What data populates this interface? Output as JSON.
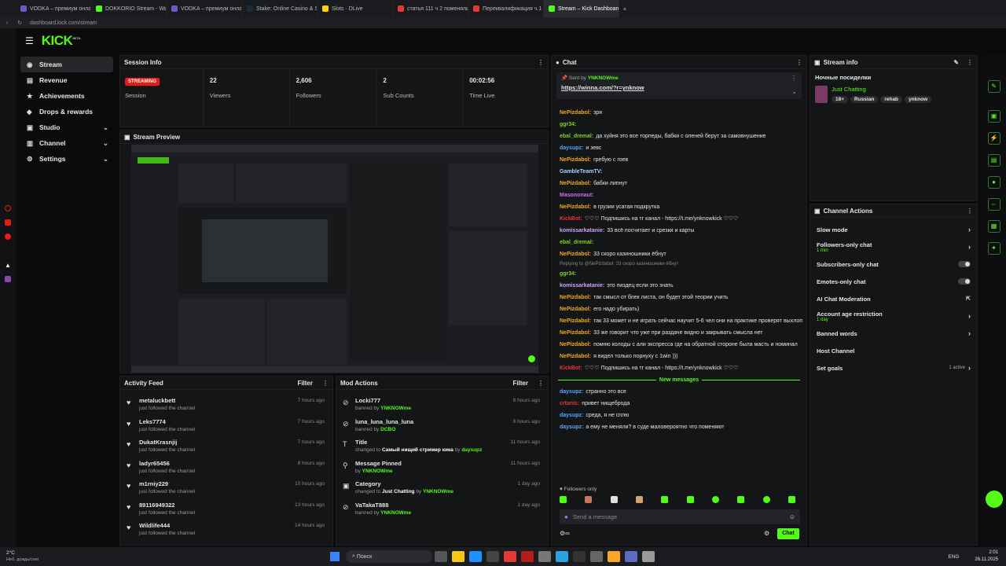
{
  "browser": {
    "tabs": [
      {
        "label": "VODKA – премиум онлайн",
        "color": "#6a5acd"
      },
      {
        "label": "DOKKORIO Stream - Watch",
        "color": "#53fc18"
      },
      {
        "label": "VODKA – премиум онлайн",
        "color": "#6a5acd"
      },
      {
        "label": "Stake: Online Casino & Sp",
        "color": "#1a2c38"
      },
      {
        "label": "Slots · DLive",
        "color": "#ffd300"
      },
      {
        "label": "статья 111 ч 2 поменяли на",
        "color": "#e53935"
      },
      {
        "label": "Переквалификация ч.1 ст",
        "color": "#e53935"
      },
      {
        "label": "Stream – Kick Dashboard",
        "color": "#53fc18"
      }
    ],
    "address": "dashboard.kick.com/stream"
  },
  "nav": {
    "logo": "KICK",
    "beta": "BETA",
    "items": [
      {
        "label": "Stream"
      },
      {
        "label": "Revenue"
      },
      {
        "label": "Achievements"
      },
      {
        "label": "Drops & rewards"
      },
      {
        "label": "Studio"
      },
      {
        "label": "Channel"
      },
      {
        "label": "Settings"
      }
    ]
  },
  "session": {
    "title": "Session Info",
    "status_badge": "STREAMING",
    "status_label": "Session",
    "viewers": "22",
    "viewers_label": "Viewers",
    "followers": "2,606",
    "followers_label": "Followers",
    "subs": "2",
    "subs_label": "Sub Counts",
    "time": "00:02:56",
    "time_label": "Time Live"
  },
  "preview": {
    "title": "Stream Preview"
  },
  "activity": {
    "title": "Activity Feed",
    "filter": "Filter",
    "items": [
      {
        "name": "metaluckbett",
        "action": "just followed the channel",
        "time": "7 hours ago"
      },
      {
        "name": "Leks7774",
        "action": "just followed the channel",
        "time": "7 hours ago"
      },
      {
        "name": "DukatKrasnjij",
        "action": "just followed the channel",
        "time": "7 hours ago"
      },
      {
        "name": "ladyr65456",
        "action": "just followed the channel",
        "time": "8 hours ago"
      },
      {
        "name": "m1rniy229",
        "action": "just followed the channel",
        "time": "10 hours ago"
      },
      {
        "name": "89116949322",
        "action": "just followed the channel",
        "time": "13 hours ago"
      },
      {
        "name": "Wildlife444",
        "action": "just followed the channel",
        "time": "14 hours ago"
      }
    ]
  },
  "mod": {
    "title": "Mod Actions",
    "filter": "Filter",
    "items": [
      {
        "name": "Locki777",
        "pre": "banned by ",
        "by": "YNKNOWme",
        "time": "8 hours ago",
        "icon": "ban-icon"
      },
      {
        "name": "luna_luna_luna_luna",
        "pre": "banned by ",
        "by": "DCBO",
        "time": "8 hours ago",
        "icon": "ban-icon"
      },
      {
        "name": "Title",
        "pre": "changed to ",
        "extra": "Самый нищий стример кика",
        "mid": " by ",
        "by": "daysupz",
        "time": "11 hours ago",
        "icon": "text-icon"
      },
      {
        "name": "Message Pinned",
        "pre": "by ",
        "by": "YNKNOWme",
        "time": "11 hours ago",
        "icon": "pin-icon"
      },
      {
        "name": "Category",
        "pre": "changed to ",
        "extra": "Just Chatting",
        "mid": " by ",
        "by": "YNKNOWme",
        "time": "1 day ago",
        "icon": "category-icon"
      },
      {
        "name": "VaTakaT888",
        "pre": "banned by ",
        "by": "YNKNOWme",
        "time": "1 day ago",
        "icon": "ban-icon"
      }
    ]
  },
  "chat": {
    "title": "Chat",
    "pinned": {
      "sent_by": "Sent by",
      "user": "YNKNOWme",
      "link": "https://winna.com/?r=ynknow"
    },
    "messages": [
      {
        "user": "NePizdabol:",
        "text": "зря",
        "color": "#f5a623"
      },
      {
        "user": "ggr34:",
        "text": "",
        "color": "#7ed321"
      },
      {
        "user": "ebal_dremal:",
        "text": "да хуйня это все торпеды, бабки с оленей берут за самовнушение",
        "color": "#7ed321"
      },
      {
        "user": "daysupz:",
        "text": "и зевс",
        "color": "#53a7fc"
      },
      {
        "user": "NePizdabol:",
        "text": "гребую с гоев",
        "color": "#f5a623"
      },
      {
        "user": "GambleTeamTV:",
        "text": "",
        "color": "#a3d2ff"
      },
      {
        "user": "NePizdabol:",
        "text": "бабки липнут",
        "color": "#f5a623"
      },
      {
        "user": "Masononaut:",
        "text": "",
        "color": "#c86bfa"
      },
      {
        "user": "NePizdabol:",
        "text": "в грузии усатая подкрутка",
        "color": "#f5a623"
      },
      {
        "user": "KickBot:",
        "text": "♡♡♡ Подпишись на тг канал - https://t.me/ynknowkick ♡♡♡",
        "color": "#e53935"
      },
      {
        "user": "komissarkatanie:",
        "text": "33 всё посчитает и срезки и карты",
        "color": "#d0a3ff"
      },
      {
        "user": "ebal_dremal:",
        "text": "",
        "color": "#7ed321"
      },
      {
        "user": "NePizdabol:",
        "text": "33 скоро казиношники ёбнут",
        "color": "#f5a623"
      },
      {
        "user": "ggr34:",
        "text": "",
        "color": "#7ed321",
        "reply": "Replying to @NePizdabol: 33 скоро казиношники ёбнут"
      },
      {
        "user": "komissarkatanie:",
        "text": "это пиздец если это знать",
        "color": "#d0a3ff"
      },
      {
        "user": "NePizdabol:",
        "text": "так смысл от блек листа, он будет этой теории учить",
        "color": "#f5a623"
      },
      {
        "user": "NePizdabol:",
        "text": "его надо убирать)",
        "color": "#f5a623"
      },
      {
        "user": "NePizdabol:",
        "text": "так 33 может и не играть сейчас научит 5-6 чел они на практике проверят выхлоп",
        "color": "#f5a623"
      },
      {
        "user": "NePizdabol:",
        "text": "33 же говорит что уже при раздаче видно и закрывать смысла нет",
        "color": "#f5a623"
      },
      {
        "user": "NePizdabol:",
        "text": "помню колоды с али экспресса где на обратной стороне была масть и номинал",
        "color": "#f5a623"
      },
      {
        "user": "NePizdabol:",
        "text": "я видел только порнуху с 1win )))",
        "color": "#f5a623"
      },
      {
        "user": "KickBot:",
        "text": "♡♡♡ Подпишись на тг канал - https://t.me/ynknowkick ♡♡♡",
        "color": "#e53935"
      }
    ],
    "new_messages": "New messages",
    "new": [
      {
        "user": "daysupz:",
        "text": "странно это все",
        "color": "#53a7fc"
      },
      {
        "user": "crtanis:",
        "text": "привет нищеброда",
        "color": "#e53935"
      },
      {
        "user": "daysupz:",
        "text": "среда, я не сплю",
        "color": "#53a7fc"
      },
      {
        "user": "daysupz:",
        "text": "а ему не меняли? в суде маловероятно что поменяют",
        "color": "#53a7fc"
      }
    ],
    "followers_only": "Followers only",
    "placeholder": "Send a message",
    "send": "Chat"
  },
  "stream_info": {
    "title": "Stream info",
    "name": "Ночные посиделки",
    "category": "Just Chatting",
    "tags": [
      "18+",
      "Russian",
      "rehab",
      "ynknow"
    ]
  },
  "actions": {
    "title": "Channel Actions",
    "items": [
      {
        "label": "Slow mode",
        "type": "arrow"
      },
      {
        "label": "Followers-only chat",
        "sub": "1 min",
        "type": "arrow"
      },
      {
        "label": "Subscribers-only chat",
        "type": "toggle"
      },
      {
        "label": "Emotes-only chat",
        "type": "toggle"
      },
      {
        "label": "AI Chat Moderation",
        "type": "ext"
      },
      {
        "label": "Account age restriction",
        "sub": "1 day",
        "type": "arrow"
      },
      {
        "label": "Banned words",
        "type": "arrow"
      },
      {
        "label": "Host Channel",
        "type": "none"
      },
      {
        "label": "Set goals",
        "badge": "1 active",
        "type": "arrow"
      }
    ]
  },
  "taskbar": {
    "weather": "2°C",
    "weather_sub": "Неб. дождь/снег",
    "search": "Поиск",
    "lang": "ENG",
    "time": "2:01",
    "date": "26.11.2025"
  },
  "colors": {
    "accent": "#53fc18",
    "live": "#e91916"
  }
}
